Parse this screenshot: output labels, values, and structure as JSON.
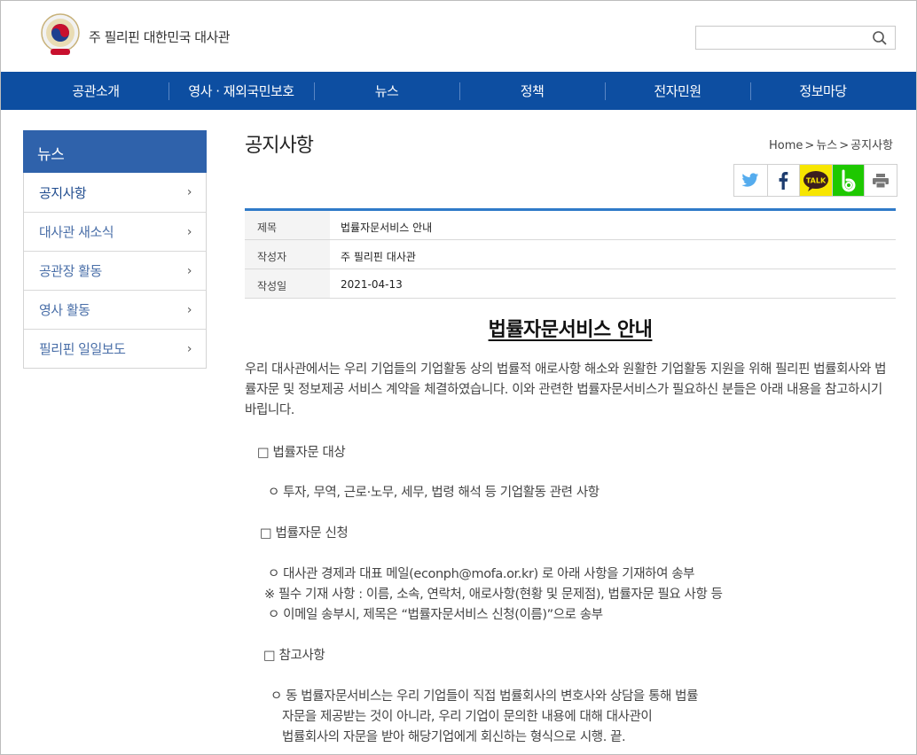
{
  "header": {
    "site_title": "주 필리핀 대한민국 대사관",
    "search": {
      "placeholder": "",
      "value": ""
    }
  },
  "gnb": [
    "공관소개",
    "영사 · 재외국민보호",
    "뉴스",
    "정책",
    "전자민원",
    "정보마당"
  ],
  "sidebar": {
    "title": "뉴스",
    "items": [
      {
        "label": "공지사항",
        "active": true
      },
      {
        "label": "대사관 새소식",
        "active": false
      },
      {
        "label": "공관장 활동",
        "active": false
      },
      {
        "label": "영사 활동",
        "active": false
      },
      {
        "label": "필리핀 일일보도",
        "active": false
      }
    ]
  },
  "page": {
    "title": "공지사항",
    "breadcrumb": [
      "Home",
      ">",
      "뉴스",
      ">",
      "공지사항"
    ]
  },
  "share": [
    "twitter-icon",
    "facebook-icon",
    "kakaotalk-icon",
    "band-icon",
    "print-icon"
  ],
  "info": [
    {
      "label": "제목",
      "value": "법률자문서비스 안내"
    },
    {
      "label": "작성자",
      "value": "주 필리핀 대사관"
    },
    {
      "label": "작성일",
      "value": "2021-04-13"
    }
  ],
  "article": {
    "title": "법률자문서비스 안내",
    "intro": "우리 대사관에서는 우리 기업들의 기업활동 상의 법률적 애로사항 해소와 원활한 기업활동 지원을 위해 필리핀 법률회사와 법률자문 및 정보제공 서비스 계약을 체결하였습니다. 이와 관련한 법률자문서비스가 필요하신 분들은 아래 내용을 참고하시기 바립니다.",
    "section1": {
      "heading": "□ 법률자문 대상",
      "line1": "ㅇ 투자, 무역, 근로·노무, 세무, 법령 해석 등 기업활동 관련 사항"
    },
    "section2": {
      "heading": "□ 법률자문 신청",
      "line1": "ㅇ 대사관 경제과 대표 메일(econph@mofa.or.kr) 로 아래 사항을 기재하여 송부",
      "line2": "※ 필수 기재 사항 : 이름, 소속, 연락처, 애로사항(현황 및 문제점), 법률자문 필요 사항 등",
      "line3": "ㅇ 이메일 송부시, 제목은 “법률자문서비스 신청(이름)”으로 송부"
    },
    "section3": {
      "heading": "□ 참고사항",
      "line1": "ㅇ 동 법률자문서비스는 우리 기업들이 직접 법률회사의 변호사와 상담을 통해 법률",
      "line2": "자문을 제공받는 것이 아니라, 우리 기업이 문의한 내용에 대해 대사관이",
      "line3": "법률회사의 자문을 받아 해당기업에게 회신하는 형식으로 시행.  끝."
    }
  },
  "colors": {
    "gnb": "#0d4ea1",
    "lnb_title": "#2f62ab",
    "table_top": "#2f7ac8"
  }
}
